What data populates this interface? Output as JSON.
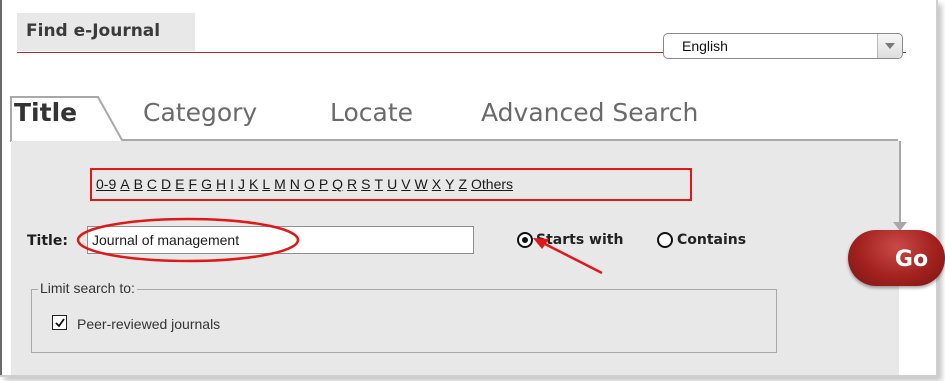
{
  "header": {
    "title": "Find e-Journal"
  },
  "language": {
    "value": "English"
  },
  "tabs": [
    {
      "label": "Title",
      "active": true
    },
    {
      "label": "Category"
    },
    {
      "label": "Locate"
    },
    {
      "label": "Advanced Search"
    }
  ],
  "alphabet": [
    "0-9",
    "A",
    "B",
    "C",
    "D",
    "E",
    "F",
    "G",
    "H",
    "I",
    "J",
    "K",
    "L",
    "M",
    "N",
    "O",
    "P",
    "Q",
    "R",
    "S",
    "T",
    "U",
    "V",
    "W",
    "X",
    "Y",
    "Z",
    "Others"
  ],
  "search": {
    "label": "Title:",
    "value": "Journal of management",
    "options": [
      {
        "label": "Starts with",
        "selected": true
      },
      {
        "label": "Contains",
        "selected": false
      }
    ],
    "go_label": "Go"
  },
  "limit": {
    "legend": "Limit search to:",
    "checkbox_label": "Peer-reviewed journals",
    "checked": true
  },
  "colors": {
    "accent_red": "#b5282a",
    "annotation_red": "#e01818",
    "panel_bg": "#e8e8e8",
    "go_button": "#a3221f"
  }
}
